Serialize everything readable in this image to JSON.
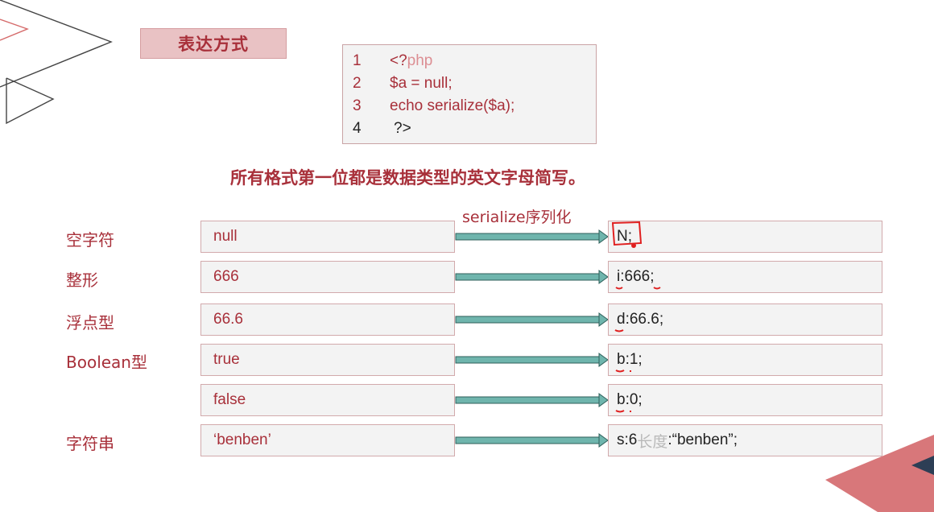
{
  "slide": {
    "title": "表达方式",
    "code": [
      {
        "num": "1",
        "prefix": "<?",
        "keyword": "php"
      },
      {
        "num": "2",
        "text": "$a = null;"
      },
      {
        "num": "3",
        "text": "echo serialize($a);"
      },
      {
        "num": "4",
        "text": "?>"
      }
    ],
    "description": "所有格式第一位都是数据类型的英文字母简写。",
    "arrow_caption": "serialize序列化",
    "rows": [
      {
        "type_label": "空字符",
        "input": "null",
        "output_prefix": "N;",
        "output_hint": "",
        "output_suffix": ""
      },
      {
        "type_label": "整形",
        "input": "666",
        "output_prefix": "i:666;",
        "output_hint": "",
        "output_suffix": ""
      },
      {
        "type_label": "浮点型",
        "input": "66.6",
        "output_prefix": "d:66.6;",
        "output_hint": "",
        "output_suffix": ""
      },
      {
        "type_label": "Boolean型",
        "input": "true",
        "output_prefix": "b:1;",
        "output_hint": "",
        "output_suffix": ""
      },
      {
        "type_label": "",
        "input": "false",
        "output_prefix": "b:0;",
        "output_hint": "",
        "output_suffix": ""
      },
      {
        "type_label": "字符串",
        "input": "‘benben’",
        "output_prefix": "s:6",
        "output_hint": "长度",
        "output_suffix": ":“benben”;"
      }
    ],
    "colors": {
      "accent": "#a8303a",
      "title_fill": "#e9c2c4",
      "arrow": "#6fb5ad",
      "cell_fill": "#f3f3f3",
      "annotation": "#e02020"
    }
  }
}
